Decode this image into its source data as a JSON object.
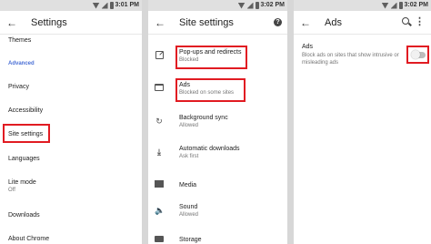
{
  "status_time_1": "3:01 PM",
  "status_time_2": "3:02 PM",
  "status_time_3": "3:02 PM",
  "panel1": {
    "title": "Settings",
    "items": [
      {
        "label": "Themes"
      },
      {
        "label": "Advanced",
        "section": true
      },
      {
        "label": "Privacy"
      },
      {
        "label": "Accessibility"
      },
      {
        "label": "Site settings"
      },
      {
        "label": "Languages"
      },
      {
        "label": "Lite mode",
        "sub": "Off"
      },
      {
        "label": "Downloads"
      },
      {
        "label": "About Chrome"
      }
    ]
  },
  "panel2": {
    "title": "Site settings",
    "help": "?",
    "rows": [
      {
        "label": "Pop-ups and redirects",
        "sub": "Blocked",
        "icon": "popup-icon"
      },
      {
        "label": "Ads",
        "sub": "Blocked on some sites",
        "icon": "ads-icon"
      },
      {
        "label": "Background sync",
        "sub": "Allowed",
        "icon": "sync-icon"
      },
      {
        "label": "Automatic downloads",
        "sub": "Ask first",
        "icon": "download-icon"
      },
      {
        "label": "Media",
        "sub": "",
        "icon": "media-icon"
      },
      {
        "label": "Sound",
        "sub": "Allowed",
        "icon": "sound-icon"
      },
      {
        "label": "Storage",
        "sub": "",
        "icon": "storage-icon"
      }
    ]
  },
  "panel3": {
    "title": "Ads",
    "setting_title": "Ads",
    "setting_desc": "Block ads on sites that show intrusive or misleading ads",
    "toggle_on": false
  },
  "colors": {
    "highlight": "#e11b22",
    "section": "#4a6fd6"
  }
}
